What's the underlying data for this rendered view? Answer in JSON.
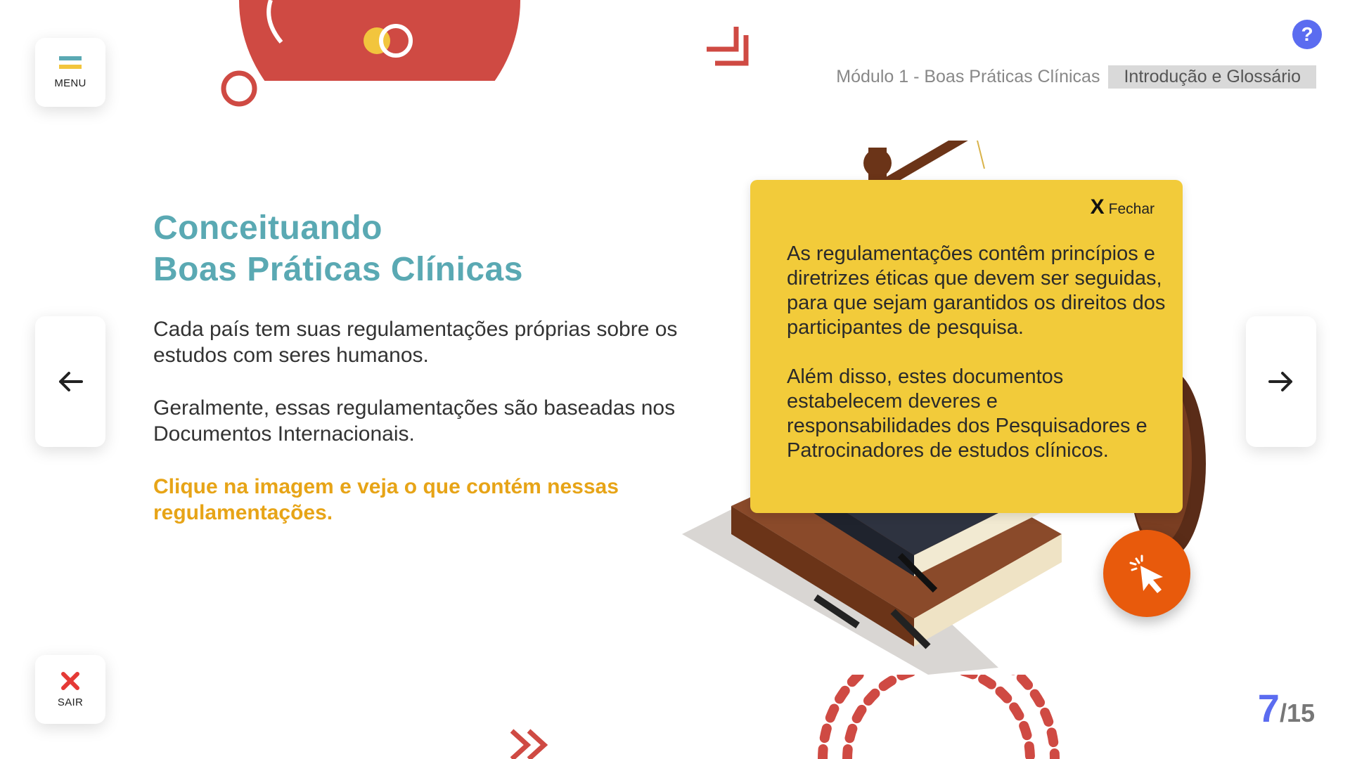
{
  "header": {
    "menu_label": "MENU",
    "help_label": "?",
    "breadcrumb": {
      "module": "Módulo 1 - Boas Práticas Clínicas",
      "current": "Introdução e Glossário"
    }
  },
  "content": {
    "title_line1": "Conceituando",
    "title_line2": "Boas Práticas Clínicas",
    "paragraph1": "Cada país tem suas regulamentações próprias sobre os estudos com seres humanos.",
    "paragraph2": "Geralmente, essas regulamentações são baseadas nos Documentos Internacionais.",
    "call_to_action": "Clique na imagem e veja o que contém nessas regulamentações."
  },
  "popup": {
    "close_symbol": "X",
    "close_label": "Fechar",
    "paragraph1": "As regulamentações contêm princípios e diretrizes éticas que devem ser seguidas, para que sejam garantidos os direitos dos participantes de pesquisa.",
    "paragraph2": "Além disso, estes documentos estabelecem deveres e responsabilidades dos Pesquisadores e Patrocinadores de estudos clínicos."
  },
  "navigation": {
    "exit_label": "SAIR",
    "prev_icon": "arrow-left-icon",
    "next_icon": "arrow-right-icon"
  },
  "pagination": {
    "current": "7",
    "total": "/15"
  },
  "colors": {
    "title": "#5aa9b3",
    "cta": "#e7a417",
    "popup_bg": "#f2cb3a",
    "accent_blue": "#5b6cf0",
    "click_button": "#e85a0c",
    "decor_red": "#cf4a43"
  },
  "icons": [
    "menu-icon",
    "help-icon",
    "close-icon",
    "exit-icon",
    "arrow-left-icon",
    "arrow-right-icon",
    "cursor-click-icon"
  ]
}
